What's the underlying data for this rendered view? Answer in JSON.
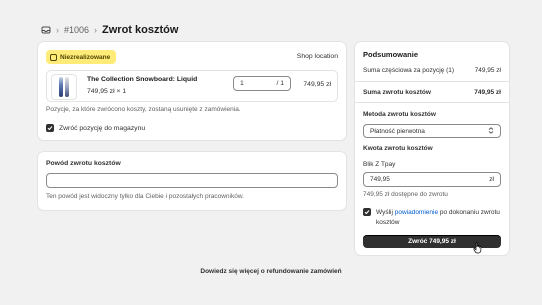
{
  "breadcrumb": {
    "icon": "orders-icon",
    "order_number": "#1006",
    "title": "Zwrot kosztów"
  },
  "items_card": {
    "status_badge": "Niezrealizowane",
    "location": "Shop location",
    "product": {
      "name": "The Collection Snowboard: Liquid",
      "price_line": "749,95 zł × 1",
      "quantity_value": "1",
      "quantity_total": "/ 1",
      "line_total": "749,95 zł"
    },
    "note": "Pozycje, za które zwrócono koszty, zostaną usunięte z zamówienia.",
    "restock_label": "Zwróć pozycję do magazynu",
    "restock_checked": true
  },
  "reason_card": {
    "label": "Powód zwrotu kosztów",
    "input_value": "",
    "help": "Ten powód jest widoczny tylko dla Ciebie i pozostałych pracowników."
  },
  "footer_link": "Dowiedz się więcej o refundowanie zamówień",
  "summary": {
    "title": "Podsumowanie",
    "subtotal_label": "Suma częściowa za pozycję (1)",
    "subtotal_value": "749,95 zł",
    "total_label": "Suma zwrotu kosztów",
    "total_value": "749,95 zł",
    "method_label": "Metoda zwrotu kosztów",
    "method_value": "Płatność pierwotna",
    "amount_label": "Kwota zwrotu kosztów",
    "gateway_label": "Blik Z Tpay",
    "amount_value": "749,95",
    "currency": "zł",
    "available_text": "749,95 zł dostępne do zwrotu",
    "notify_prefix": "Wyślij ",
    "notify_link": "powiadomienie",
    "notify_suffix": " po dokonaniu zwrotu kosztów",
    "notify_checked": true,
    "refund_button": "Zwróć 749,95 zł"
  },
  "colors": {
    "badge_bg": "#ffeb78",
    "primary_button": "#303030",
    "link": "#005bd3"
  }
}
